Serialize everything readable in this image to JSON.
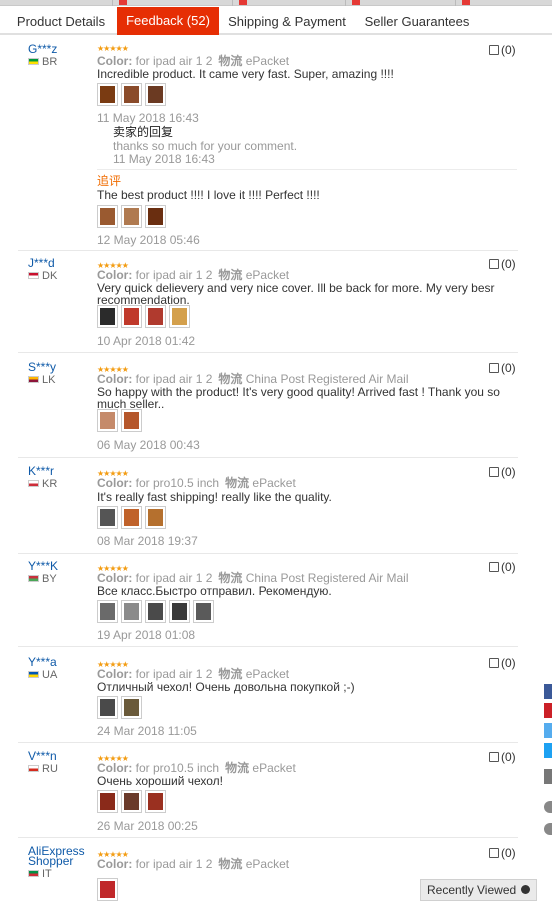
{
  "tabs": [
    {
      "label": "Product Details",
      "active": false
    },
    {
      "label": "Feedback (52)",
      "active": true
    },
    {
      "label": "Shipping & Payment",
      "active": false
    },
    {
      "label": "Seller Guarantees",
      "active": false
    }
  ],
  "colors": {
    "accent": "#e62e04",
    "username": "#0f5aa8",
    "star": "#f39c12",
    "followup": "#f06b00"
  },
  "labels": {
    "color_prefix": "Color:",
    "logistics": "物流",
    "stars": "★★★★★",
    "recently_viewed": "Recently Viewed"
  },
  "reviews": [
    {
      "user": "G***z",
      "country": "BR",
      "flag": [
        "#009b3a",
        "#fedf00"
      ],
      "color": "for ipad air 1 2",
      "shipping": "ePacket",
      "text": "Incredible product. It came very fast. Super, amazing !!!!",
      "images": [
        "#7a3b12",
        "#8a4b2a",
        "#6b3a22"
      ],
      "date": "11 May 2018 16:43",
      "likes": "(0)",
      "reply": {
        "title": "卖家的回复",
        "text": "thanks so much for your comment.",
        "date": "11 May 2018 16:43"
      },
      "followup": {
        "label": "追评",
        "text": "The best product !!!! I love it !!!! Perfect !!!!",
        "images": [
          "#9a5a30",
          "#b07a50",
          "#6a2e10"
        ],
        "date": "12 May 2018 05:46"
      }
    },
    {
      "user": "J***d",
      "country": "DK",
      "flag": [
        "#c8102e",
        "#ffffff"
      ],
      "color": "for ipad air 1 2",
      "shipping": "ePacket",
      "text": "Very quick delievery and very nice cover. Ill be back for more. My very besr recommendation.",
      "images": [
        "#2b2b2b",
        "#c0392b",
        "#b03a2e",
        "#d4a04c"
      ],
      "date": "10 Apr 2018 01:42",
      "likes": "(0)"
    },
    {
      "user": "S***y",
      "country": "LK",
      "flag": [
        "#ffb700",
        "#8d153a"
      ],
      "color": "for ipad air 1 2",
      "shipping": "China Post Registered Air Mail",
      "text": "So happy with the product! It's very good quality! Arrived fast ! Thank you so much seller..",
      "images": [
        "#c58a6a",
        "#b5562a"
      ],
      "date": "06 May 2018 00:43",
      "likes": "(0)"
    },
    {
      "user": "K***r",
      "country": "KR",
      "flag": [
        "#ffffff",
        "#cd2e3a"
      ],
      "color": "for pro10.5 inch",
      "shipping": "ePacket",
      "text": "It's really fast shipping! really like the quality.",
      "images": [
        "#555555",
        "#c0622a",
        "#b5702e"
      ],
      "date": "08 Mar 2018 19:37",
      "likes": "(0)"
    },
    {
      "user": "Y***K",
      "country": "BY",
      "flag": [
        "#c8313e",
        "#4aa657"
      ],
      "color": "for ipad air 1 2",
      "shipping": "China Post Registered Air Mail",
      "text": "Все класс.Быстро отправил. Рекомендую.",
      "images": [
        "#6a6a6a",
        "#8a8a8a",
        "#4a4a4a",
        "#3a3a3a",
        "#5a5a5a"
      ],
      "date": "19 Apr 2018 01:08",
      "likes": "(0)"
    },
    {
      "user": "Y***a",
      "country": "UA",
      "flag": [
        "#0057b7",
        "#ffd700"
      ],
      "color": "for ipad air 1 2",
      "shipping": "ePacket",
      "text": "Отличный чехол! Очень довольна покупкой ;-)",
      "images": [
        "#4a4a4a",
        "#6a5a3a"
      ],
      "date": "24 Mar 2018 11:05",
      "likes": "(0)"
    },
    {
      "user": "V***n",
      "country": "RU",
      "flag": [
        "#ffffff",
        "#d52b1e"
      ],
      "color": "for pro10.5 inch",
      "shipping": "ePacket",
      "text": "Очень хороший чехол!",
      "images": [
        "#8a2a1a",
        "#6a3a2a",
        "#9a3020"
      ],
      "date": "26 Mar 2018 00:25",
      "likes": "(0)"
    },
    {
      "user": "AliExpress Shopper",
      "country": "IT",
      "flag": [
        "#009246",
        "#ce2b37"
      ],
      "color": "for ipad air 1 2",
      "shipping": "ePacket",
      "text": "",
      "images": [
        "#c0282a"
      ],
      "date": "",
      "likes": "(0)"
    }
  ],
  "share_colors": [
    "#3b5998",
    "#cb2027",
    "#55acee",
    "#1da1f2",
    "#777777"
  ]
}
